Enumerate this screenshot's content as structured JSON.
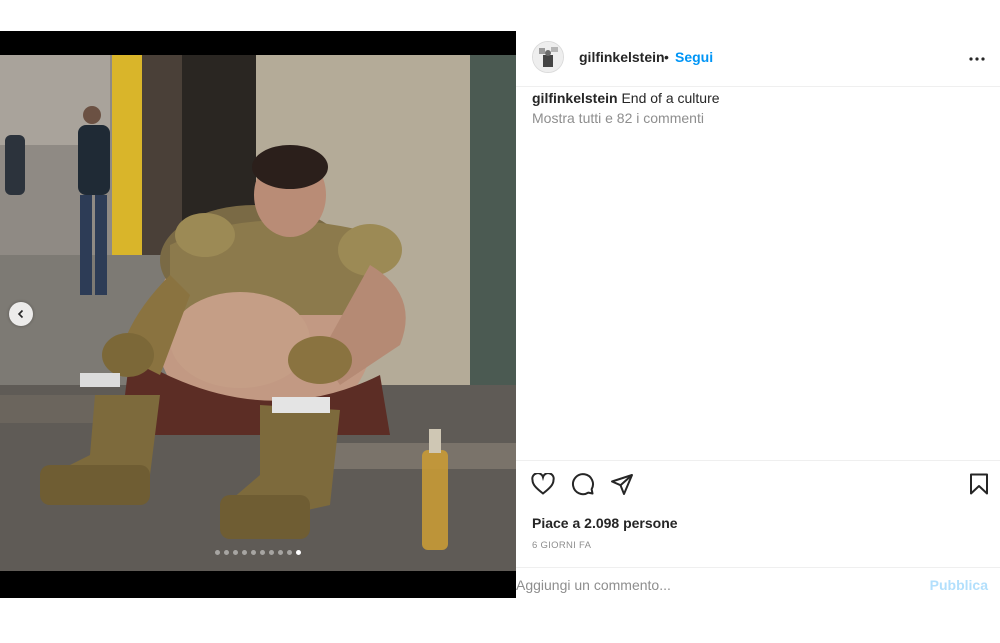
{
  "post": {
    "username": "gilfinkelstein",
    "separator": "•",
    "follow_label": "Segui",
    "caption_user": "gilfinkelstein",
    "caption_text": "End of a culture",
    "view_comments": "Mostra tutti e 82 i commenti",
    "likes": "Piace a 2.098 persone",
    "time": "6 GIORNI FA"
  },
  "carousel": {
    "total": 10,
    "active_index": 9
  },
  "comment": {
    "placeholder": "Aggiungi un commento...",
    "publish_label": "Pubblica"
  },
  "icons": {
    "more": "more-options-icon",
    "like": "heart-icon",
    "comment": "comment-icon",
    "share": "share-icon",
    "save": "bookmark-icon",
    "prev": "chevron-left-icon"
  },
  "colors": {
    "link": "#0095f6",
    "muted": "#8e8e8e",
    "publish_disabled": "#b2dffc"
  }
}
